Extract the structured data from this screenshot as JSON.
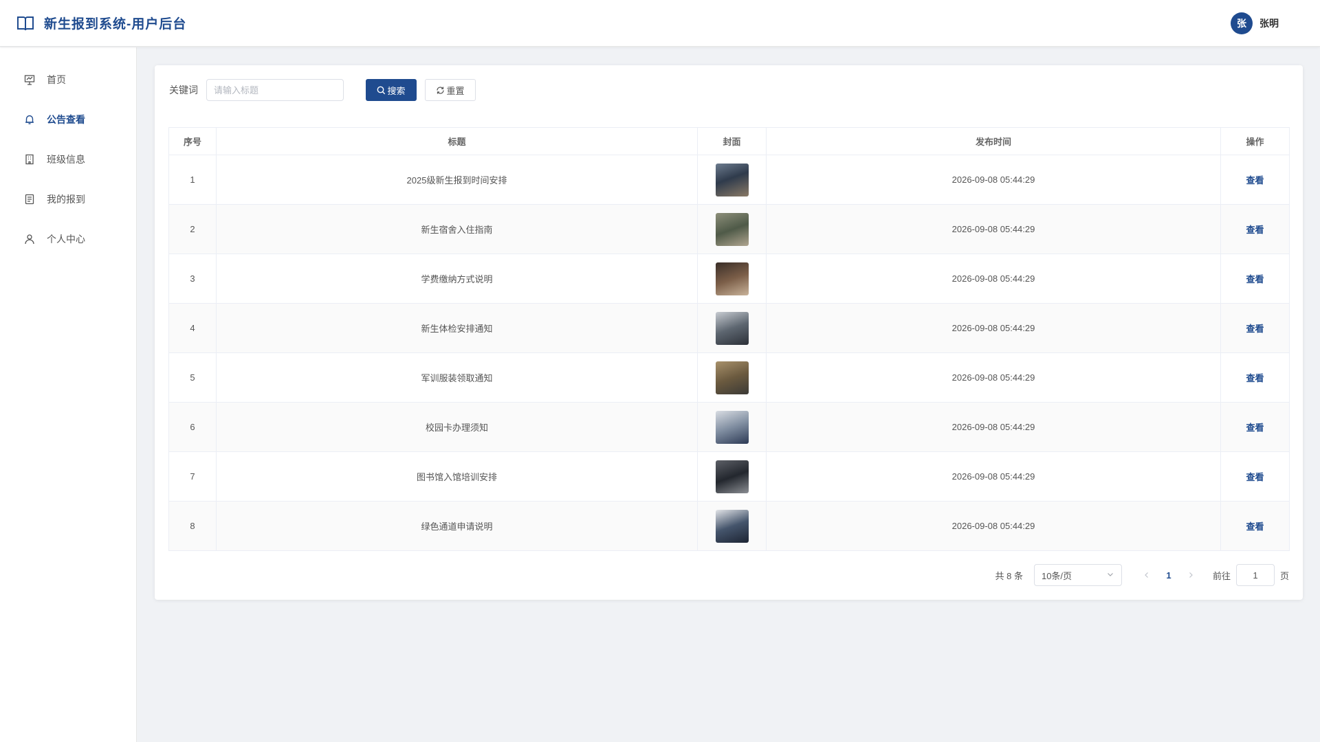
{
  "header": {
    "app_title": "新生报到系统-用户后台",
    "user": {
      "avatar_text": "张",
      "name": "张明"
    }
  },
  "sidebar": {
    "items": [
      {
        "label": "首页",
        "icon": "presentation-icon",
        "active": false
      },
      {
        "label": "公告查看",
        "icon": "bell-icon",
        "active": true
      },
      {
        "label": "班级信息",
        "icon": "building-icon",
        "active": false
      },
      {
        "label": "我的报到",
        "icon": "document-icon",
        "active": false
      },
      {
        "label": "个人中心",
        "icon": "user-icon",
        "active": false
      }
    ]
  },
  "search": {
    "keyword_label": "关键词",
    "placeholder": "请输入标题",
    "value": "",
    "search_button": "搜索",
    "reset_button": "重置"
  },
  "table": {
    "columns": [
      "序号",
      "标题",
      "封面",
      "发布时间",
      "操作"
    ],
    "action_label": "查看",
    "rows": [
      {
        "index": "1",
        "title": "2025级新生报到时间安排",
        "time": "2026-09-08 05:44:29"
      },
      {
        "index": "2",
        "title": "新生宿舍入住指南",
        "time": "2026-09-08 05:44:29"
      },
      {
        "index": "3",
        "title": "学费缴纳方式说明",
        "time": "2026-09-08 05:44:29"
      },
      {
        "index": "4",
        "title": "新生体检安排通知",
        "time": "2026-09-08 05:44:29"
      },
      {
        "index": "5",
        "title": "军训服装领取通知",
        "time": "2026-09-08 05:44:29"
      },
      {
        "index": "6",
        "title": "校园卡办理须知",
        "time": "2026-09-08 05:44:29"
      },
      {
        "index": "7",
        "title": "图书馆入馆培训安排",
        "time": "2026-09-08 05:44:29"
      },
      {
        "index": "8",
        "title": "绿色通道申请说明",
        "time": "2026-09-08 05:44:29"
      }
    ]
  },
  "pagination": {
    "total_text": "共 8 条",
    "page_size": "10条/页",
    "current_page": "1",
    "goto_label": "前往",
    "goto_value": "1",
    "page_unit": "页"
  },
  "colors": {
    "primary": "#1f4b8f",
    "background": "#f0f2f5"
  }
}
